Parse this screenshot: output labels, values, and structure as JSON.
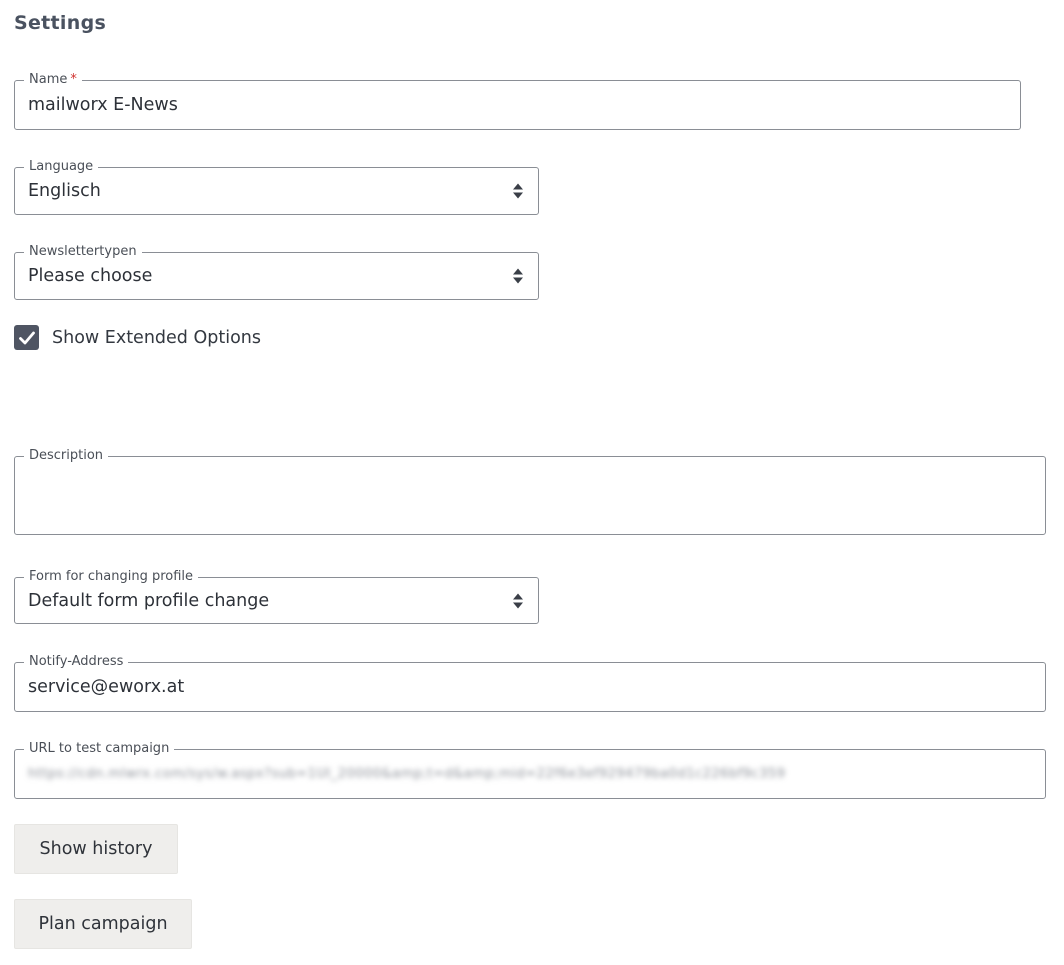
{
  "page": {
    "title": "Settings"
  },
  "fields": {
    "name": {
      "label": "Name",
      "required_mark": "*",
      "value": "mailworx E-News"
    },
    "language": {
      "label": "Language",
      "value": "Englisch"
    },
    "newsletter_type": {
      "label": "Newslettertypen",
      "value": "Please choose"
    },
    "extended_options": {
      "label": "Show Extended Options",
      "checked": true
    },
    "description": {
      "label": "Description",
      "value": ""
    },
    "profile_form": {
      "label": "Form for changing profile",
      "value": "Default form profile change"
    },
    "notify_address": {
      "label": "Notify-Address",
      "value": "service@eworx.at"
    },
    "test_url": {
      "label": "URL to test campaign",
      "value": "https://cdn.mlwrx.com/sys/w.aspx?sub=1UI_20000&amp;t=d&amp;mid=22f6e3ef929479ba0d1c226bf9c359",
      "obscured": true
    }
  },
  "buttons": {
    "history": "Show history",
    "plan": "Plan campaign"
  },
  "colors": {
    "border": "#8a8e95",
    "checkbox_fill": "#4f5563",
    "required": "#d0312d",
    "button_bg": "#efeeec"
  }
}
